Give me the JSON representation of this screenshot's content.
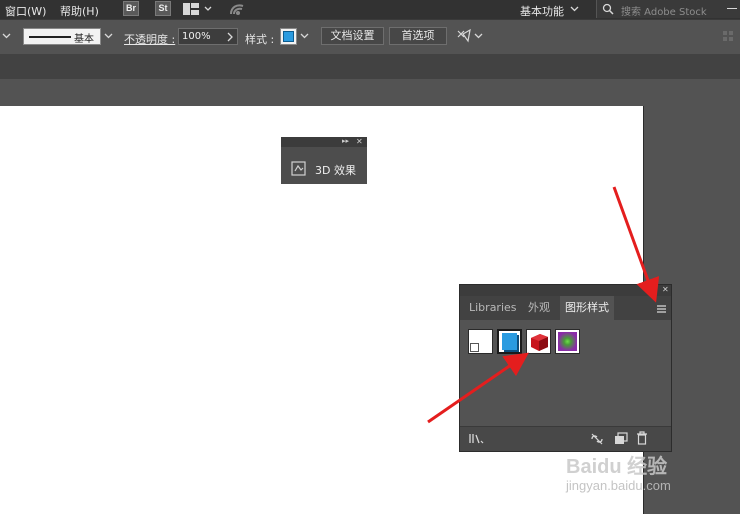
{
  "menubar": {
    "items": [
      "窗口(W)",
      "帮助(H)"
    ],
    "app_icons": [
      "Br",
      "St"
    ],
    "workspace_label": "基本功能",
    "search_placeholder": "搜索 Adobe Stock"
  },
  "controlbar": {
    "stroke_profile_label": "基本",
    "opacity_label": "不透明度 :",
    "opacity_value": "100%",
    "style_label": "样式 :",
    "document_setup_button": "文档设置",
    "preferences_button": "首选项"
  },
  "panel_3d": {
    "label": "3D 效果"
  },
  "graphic_styles_panel": {
    "tabs": [
      "Libraries",
      "外观",
      "图形样式"
    ],
    "active_tab": "图形样式",
    "swatches": [
      {
        "name": "default-style-swatch",
        "color": "#ffffff"
      },
      {
        "name": "blue-style-swatch",
        "color": "#2a9be0"
      },
      {
        "name": "red-3d-style-swatch",
        "color": "#c8141c"
      },
      {
        "name": "purple-green-glow-style-swatch",
        "color": "#8a2ca8"
      }
    ]
  },
  "watermark": {
    "brand": "Baidu 经验",
    "url": "jingyan.baidu.com"
  },
  "colors": {
    "annotation_arrow": "#e41e1e",
    "ui_background": "#535353"
  }
}
